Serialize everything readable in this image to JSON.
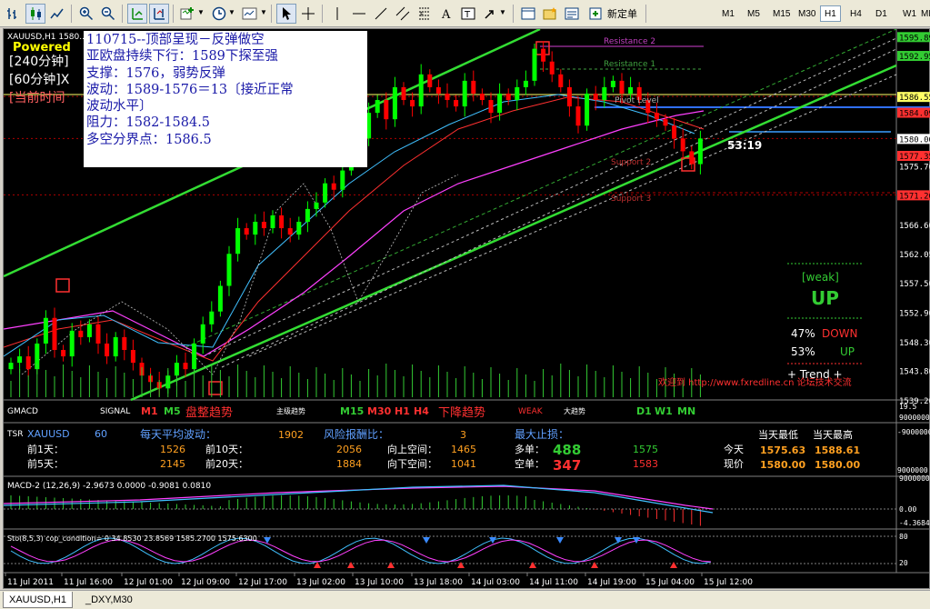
{
  "toolbar": {
    "new_order_label": "新定单",
    "timeframes": [
      "M1",
      "M5",
      "M15",
      "M30",
      "H1",
      "H4",
      "D1",
      "W1",
      "MN"
    ],
    "active_timeframe": "H1"
  },
  "chart": {
    "symbol_label": "XAUUSD,H1  1580...",
    "powered_label": "Powered",
    "period_labels": [
      "[240分钟]",
      "[60分钟]X",
      "[当前时间"
    ],
    "price_axis": [
      "1595.89",
      "1592.95",
      "1586.55",
      "1584.09",
      "1580.00",
      "1577.35",
      "1575.70",
      "1571.20",
      "1566.60",
      "1562.05",
      "1557.50",
      "1552.90",
      "1548.30",
      "1543.80",
      "1539.20"
    ],
    "levels": {
      "resistance2": "Resistance 2",
      "resistance1": "Resistance 1",
      "pivot": "Pivot Level",
      "support2": "Support 2",
      "support3": "Support 3"
    },
    "countdown": "53:19",
    "trend_box": {
      "weak": "[weak]",
      "direction": "UP",
      "down_pct": "47%",
      "down_label": "DOWN",
      "up_pct": "53%",
      "up_label": "UP",
      "trend_label": "+ Trend +"
    },
    "site_label": "欢迎到 http://www.fxredline.cn 论坛技术交流",
    "time_axis": [
      "11 Jul 2011",
      "11 Jul 16:00",
      "12 Jul 01:00",
      "12 Jul 09:00",
      "12 Jul 17:00",
      "13 Jul 02:00",
      "13 Jul 10:00",
      "13 Jul 18:00",
      "14 Jul 03:00",
      "14 Jul 11:00",
      "14 Jul 19:00",
      "15 Jul 04:00",
      "15 Jul 12:00"
    ]
  },
  "note": {
    "lines": [
      "110715--顶部呈现－反弹做空",
      "亚欧盘持续下行：1589下探至强",
      "支撑：1576，弱势反弹",
      "波动：1589-1576＝13〔接近正常",
      "波动水平〕",
      "阻力：1582-1584.5",
      "多空分界点：1586.5"
    ]
  },
  "gmacd": {
    "title": "GMACD",
    "signal": "SIGNAL",
    "m1": "M1",
    "m5": "M5",
    "range_label": "盘整趋势",
    "main_trend": "主级趋势",
    "m15": "M15",
    "m30": "M30",
    "h1": "H1",
    "h4": "H4",
    "down_label": "下降趋势",
    "weak": "WEAK",
    "big_trend": "大趋势",
    "d1": "D1",
    "w1": "W1",
    "mn": "MN",
    "scale_top": "19.5",
    "scale_bottom": "9000000"
  },
  "tsr": {
    "title": "TSR",
    "symbol": "XAUUSD",
    "period": "60",
    "avg_label": "每天平均波动：",
    "avg_value": "1902",
    "risk_label": "风险报酬比：",
    "risk_value": "3",
    "maxloss_label": "最大止损：",
    "low_label": "当天最低",
    "high_label": "当天最高",
    "rows": [
      {
        "l1": "前1天：",
        "v1": "1526",
        "l2": "前10天：",
        "v2": "2056",
        "l3": "向上空间：",
        "v3": "1465"
      },
      {
        "l1": "前5天：",
        "v1": "2145",
        "l2": "前20天：",
        "v2": "1884",
        "l3": "向下空间：",
        "v3": "1041"
      }
    ],
    "long_label": "多单：",
    "long_value": "488",
    "long_price": "1575",
    "short_label": "空单：",
    "short_value": "347",
    "short_price": "1583",
    "today_label": "今天",
    "now_label": "现价",
    "today_low": "1575.63",
    "today_high": "1588.61",
    "now_low": "1580.00",
    "now_high": "1580.00",
    "scale_top": "-9000000",
    "scale_bottom": "9000000"
  },
  "macd": {
    "title": "MACD-2 (12,26,9) -2.9673 0.0000 -0.9081 0.0810",
    "scale": [
      "0.00",
      "-4.3684",
      "9000000"
    ]
  },
  "stoch": {
    "title": "Sto(8,5,3) cop_condition=  0   34.8530 23.8569 1585.2700 1575.6300",
    "scale": [
      "80",
      "20"
    ]
  },
  "tabs": [
    "XAUUSD,H1",
    "_DXY,M30"
  ],
  "colors": {
    "up_candle": "#00ff00",
    "down_candle": "#ff0000",
    "channel": "#33cc33",
    "note_text": "#1a1aa8"
  }
}
